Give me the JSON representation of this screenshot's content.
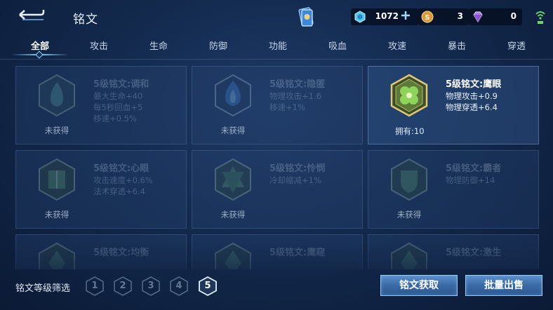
{
  "header": {
    "title": "铭文",
    "currencies": [
      {
        "icon": "diamond-icon",
        "value": "1072",
        "color": "#7fd3f5"
      },
      {
        "icon": "gold-coin-icon",
        "value": "3",
        "color": "#e2a64a"
      },
      {
        "icon": "gem-icon",
        "value": "0",
        "color": "#c58cf0"
      }
    ]
  },
  "tabs": [
    {
      "label": "全部",
      "active": true
    },
    {
      "label": "攻击"
    },
    {
      "label": "生命"
    },
    {
      "label": "防御"
    },
    {
      "label": "功能"
    },
    {
      "label": "吸血"
    },
    {
      "label": "攻速"
    },
    {
      "label": "暴击"
    },
    {
      "label": "穿透"
    }
  ],
  "cards": [
    {
      "name": "5级铭文:调和",
      "attrs": [
        "最大生命+40",
        "每5秒回血+5",
        "移速+0.5%"
      ],
      "status": "未获得",
      "owned": false,
      "gem": "teal-drop-icon"
    },
    {
      "name": "5级铭文:隐匿",
      "attrs": [
        "物理攻击+1.6",
        "移速+1%"
      ],
      "status": "未获得",
      "owned": false,
      "gem": "blue-flame-icon"
    },
    {
      "name": "5级铭文:鹰眼",
      "attrs": [
        "物理攻击+0.9",
        "物理穿透+6.4"
      ],
      "status": "拥有:10",
      "owned": true,
      "gem": "green-clover-icon"
    },
    {
      "name": "5级铭文:心眼",
      "attrs": [
        "攻击速度+0.6%",
        "法术穿透+6.4"
      ],
      "status": "未获得",
      "owned": false,
      "gem": "green-book-icon"
    },
    {
      "name": "5级铭文:怜悯",
      "attrs": [
        "冷却缩减+1%"
      ],
      "status": "未获得",
      "owned": false,
      "gem": "green-star-icon"
    },
    {
      "name": "5级铭文:霸者",
      "attrs": [
        "物理防御+14"
      ],
      "status": "未获得",
      "owned": false,
      "gem": "green-shield-icon"
    },
    {
      "name": "5级铭文:均衡",
      "attrs": [],
      "status": "",
      "owned": false,
      "gem": "green-shard-icon"
    },
    {
      "name": "5级铭文:鹰窥",
      "attrs": [],
      "status": "",
      "owned": false,
      "gem": "green-shard-icon"
    },
    {
      "name": "5级铭文:激生",
      "attrs": [],
      "status": "",
      "owned": false,
      "gem": "green-shard-icon"
    }
  ],
  "bottom": {
    "filter_label": "铭文等级筛选",
    "levels": [
      "1",
      "2",
      "3",
      "4",
      "5"
    ],
    "active_level": "5",
    "acquire_button": "铭文获取",
    "bulk_sell_button": "批量出售"
  }
}
